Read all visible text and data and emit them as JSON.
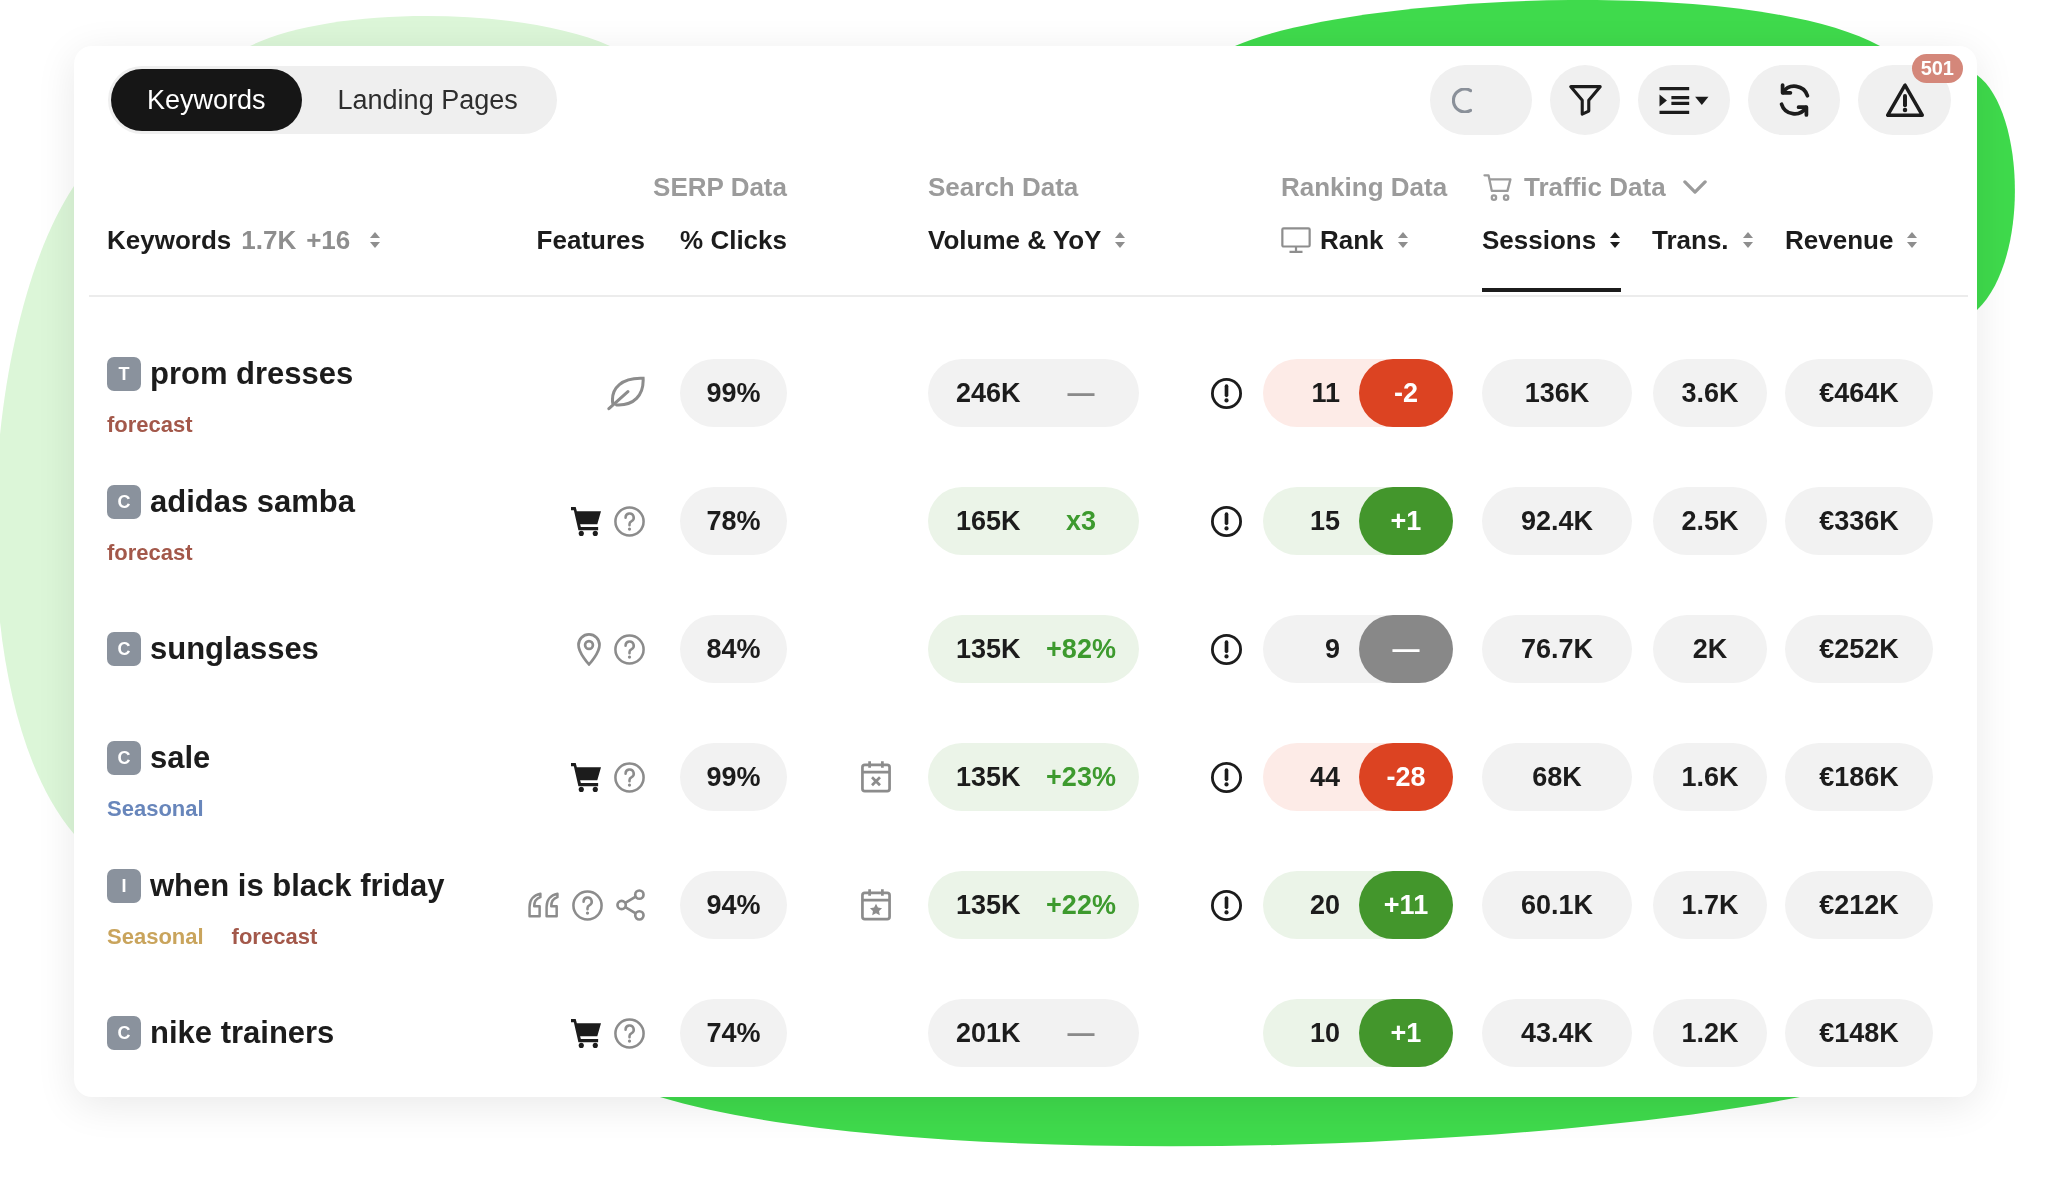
{
  "tabs": [
    {
      "label": "Keywords",
      "selected": true
    },
    {
      "label": "Landing Pages",
      "selected": false
    }
  ],
  "toolbar": {
    "warning_count": "501"
  },
  "column_groups": {
    "serp": "SERP Data",
    "search": "Search Data",
    "ranking": "Ranking Data",
    "traffic": "Traffic Data"
  },
  "columns": {
    "keyword": {
      "label": "Keywords",
      "count": "1.7K",
      "change": "+16",
      "selected": false
    },
    "features": {
      "label": "Features"
    },
    "clicks": {
      "label": "% Clicks"
    },
    "volume": {
      "label": "Volume & YoY",
      "selected": false
    },
    "rank": {
      "label": "Rank",
      "selected": false
    },
    "sessions": {
      "label": "Sessions",
      "selected": true
    },
    "transactions": {
      "label": "Trans.",
      "selected": false
    },
    "revenue": {
      "label": "Revenue",
      "selected": false
    }
  },
  "rows": [
    {
      "intent": "T",
      "keyword": "prom dresses",
      "tags": [
        {
          "label": "forecast",
          "color": "#a3584a"
        }
      ],
      "features": [
        {
          "kind": "leaf"
        }
      ],
      "clicks": "99%",
      "volume": {
        "value": "246K",
        "yoy": "—",
        "kind": "flat"
      },
      "alert": true,
      "rank": {
        "value": "11",
        "change": "-2",
        "kind": "down"
      },
      "sessions": "136K",
      "transactions": "3.6K",
      "revenue": "€464K"
    },
    {
      "intent": "C",
      "keyword": "adidas samba",
      "tags": [
        {
          "label": "forecast",
          "color": "#a3584a"
        }
      ],
      "features": [
        {
          "kind": "cart"
        },
        {
          "kind": "help"
        }
      ],
      "clicks": "78%",
      "volume": {
        "value": "165K",
        "yoy": "x3",
        "kind": "up"
      },
      "alert": true,
      "rank": {
        "value": "15",
        "change": "+1",
        "kind": "up"
      },
      "sessions": "92.4K",
      "transactions": "2.5K",
      "revenue": "€336K"
    },
    {
      "intent": "C",
      "keyword": "sunglasses",
      "features": [
        {
          "kind": "pin"
        },
        {
          "kind": "help"
        }
      ],
      "clicks": "84%",
      "volume": {
        "value": "135K",
        "yoy": "+82%",
        "kind": "up"
      },
      "alert": true,
      "rank": {
        "value": "9",
        "change": "—",
        "kind": "flat"
      },
      "sessions": "76.7K",
      "transactions": "2K",
      "revenue": "€252K"
    },
    {
      "intent": "C",
      "keyword": "sale",
      "tags": [
        {
          "label": "Seasonal",
          "color": "#6886bb"
        }
      ],
      "features": [
        {
          "kind": "cart"
        },
        {
          "kind": "help"
        }
      ],
      "clicks": "99%",
      "calendar": {
        "kind": "cross"
      },
      "volume": {
        "value": "135K",
        "yoy": "+23%",
        "kind": "up"
      },
      "alert": true,
      "rank": {
        "value": "44",
        "change": "-28",
        "kind": "down"
      },
      "sessions": "68K",
      "transactions": "1.6K",
      "revenue": "€186K"
    },
    {
      "intent": "I",
      "keyword": "when is black friday",
      "tags": [
        {
          "label": "Seasonal",
          "color": "#c9a45c"
        },
        {
          "label": "forecast",
          "color": "#a3584a"
        }
      ],
      "features": [
        {
          "kind": "quote"
        },
        {
          "kind": "help"
        },
        {
          "kind": "share"
        }
      ],
      "clicks": "94%",
      "calendar": {
        "kind": "star"
      },
      "volume": {
        "value": "135K",
        "yoy": "+22%",
        "kind": "up"
      },
      "alert": true,
      "rank": {
        "value": "20",
        "change": "+11",
        "kind": "up"
      },
      "sessions": "60.1K",
      "transactions": "1.7K",
      "revenue": "€212K"
    },
    {
      "intent": "C",
      "keyword": "nike trainers",
      "features": [
        {
          "kind": "cart"
        },
        {
          "kind": "help"
        }
      ],
      "clicks": "74%",
      "volume": {
        "value": "201K",
        "yoy": "—",
        "kind": "flat"
      },
      "alert": false,
      "rank": {
        "value": "10",
        "change": "+1",
        "kind": "up"
      },
      "sessions": "43.4K",
      "transactions": "1.2K",
      "revenue": "€148K"
    }
  ]
}
